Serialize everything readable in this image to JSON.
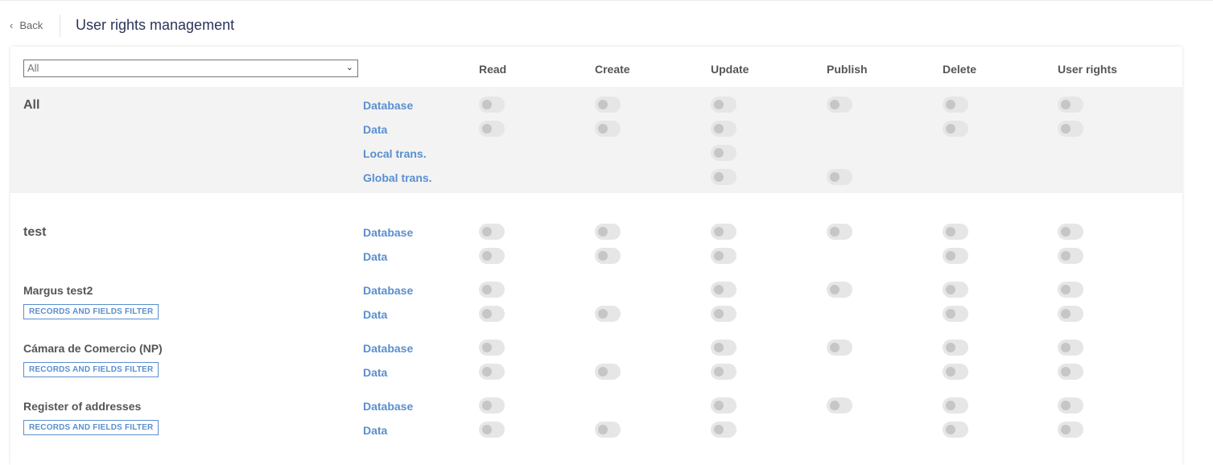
{
  "header": {
    "back_label": "Back",
    "title": "User rights management"
  },
  "filter_select": {
    "value": "All"
  },
  "columns": [
    "Read",
    "Create",
    "Update",
    "Publish",
    "Delete",
    "User rights"
  ],
  "row_labels": {
    "database": "Database",
    "data": "Data",
    "local_trans": "Local trans.",
    "global_trans": "Global trans."
  },
  "filter_button_label": "RECORDS AND FIELDS FILTER",
  "groups": [
    {
      "name": "All"
    },
    {
      "name": "test"
    },
    {
      "name": "Margus test2"
    },
    {
      "name": "Cámara de Comercio (NP)"
    },
    {
      "name": "Register of addresses"
    }
  ]
}
